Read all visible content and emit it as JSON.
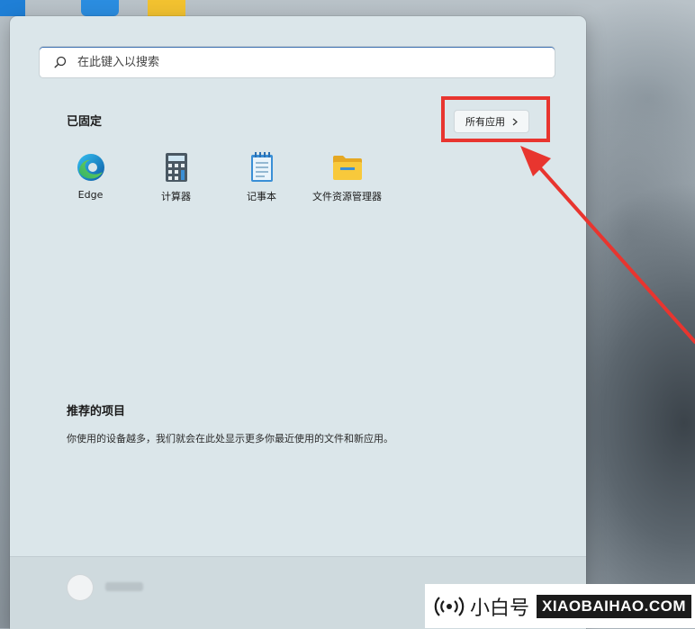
{
  "search": {
    "placeholder": "在此键入以搜索"
  },
  "pinned": {
    "title": "已固定",
    "all_apps_label": "所有应用",
    "apps": [
      {
        "label": "Edge",
        "icon": "edge-icon"
      },
      {
        "label": "计算器",
        "icon": "calculator-icon"
      },
      {
        "label": "记事本",
        "icon": "notepad-icon"
      },
      {
        "label": "文件资源管理器",
        "icon": "folder-icon"
      }
    ]
  },
  "recommended": {
    "title": "推荐的项目",
    "description": "你使用的设备越多，我们就会在此处显示更多你最近使用的文件和新应用。"
  },
  "watermark": {
    "cn": "小白号",
    "en": "XIAOBAIHAO.COM"
  },
  "colors": {
    "highlight": "#e8352f",
    "menu_bg": "#dbe6ea"
  }
}
